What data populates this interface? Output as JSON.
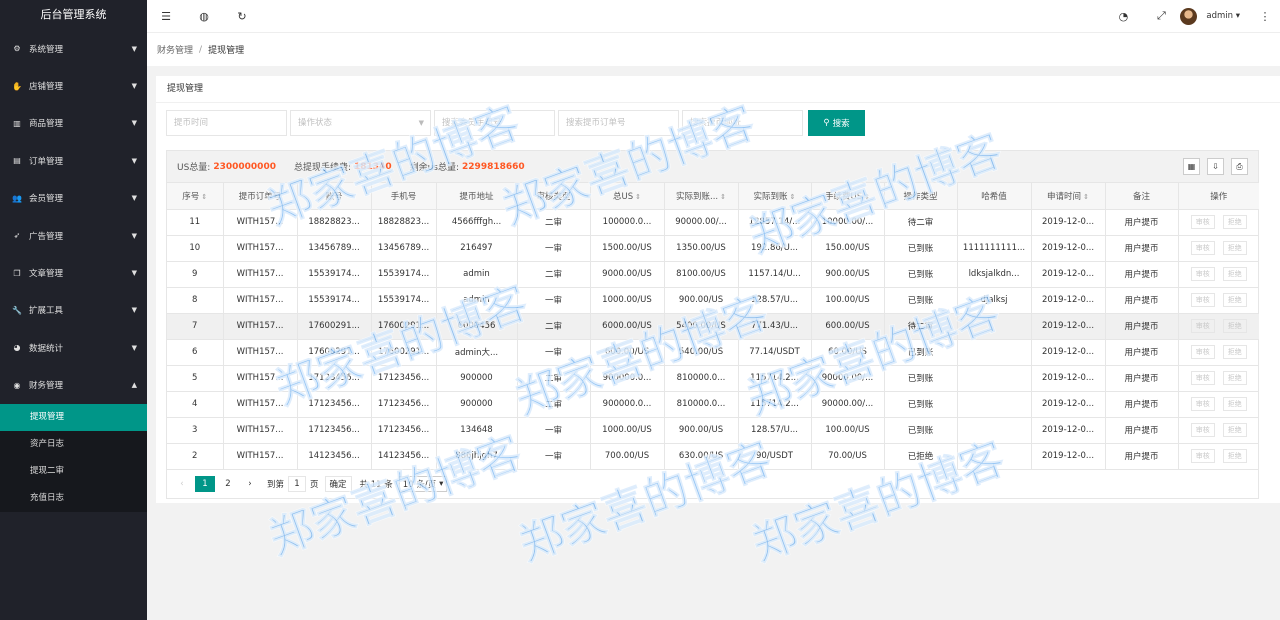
{
  "app": {
    "title": "后台管理系统"
  },
  "sidebar": {
    "items": [
      {
        "label": "系统管理",
        "icon": "gear-icon",
        "glyph": "⚙"
      },
      {
        "label": "店铺管理",
        "icon": "hand-icon",
        "glyph": "✋"
      },
      {
        "label": "商品管理",
        "icon": "bar-chart-icon",
        "glyph": "▥"
      },
      {
        "label": "订单管理",
        "icon": "calendar-icon",
        "glyph": "▤"
      },
      {
        "label": "会员管理",
        "icon": "users-icon",
        "glyph": "👥"
      },
      {
        "label": "广告管理",
        "icon": "rocket-icon",
        "glyph": "➶"
      },
      {
        "label": "文章管理",
        "icon": "copy-icon",
        "glyph": "❐"
      },
      {
        "label": "扩展工具",
        "icon": "wrench-icon",
        "glyph": "🔧"
      },
      {
        "label": "数据统计",
        "icon": "pie-chart-icon",
        "glyph": "◕"
      },
      {
        "label": "财务管理",
        "icon": "coin-icon",
        "glyph": "◉"
      }
    ],
    "submenu": [
      {
        "label": "提现管理",
        "active": true
      },
      {
        "label": "资产日志",
        "active": false
      },
      {
        "label": "提现二审",
        "active": false
      },
      {
        "label": "充值日志",
        "active": false
      }
    ]
  },
  "header": {
    "left_icons": [
      "menu-toggle-icon",
      "globe-icon",
      "refresh-icon"
    ],
    "right_icons": [
      "theme-icon",
      "fullscreen-icon"
    ],
    "user": "admin"
  },
  "breadcrumb": {
    "parent": "财务管理",
    "separator": "/",
    "current": "提现管理"
  },
  "card": {
    "title": "提现管理"
  },
  "search": {
    "time_placeholder": "提币时间",
    "status_placeholder": "操作状态",
    "phone_placeholder": "搜索会员手机号",
    "order_placeholder": "搜索提币订单号",
    "address_placeholder": "搜索提币地址",
    "button": "搜索"
  },
  "toolbar": {
    "total_label": "US总量:",
    "total_value": "2300000000",
    "fee_label": "总提现手续费:",
    "fee_value": "181340",
    "remain_label": "剩余us总量:",
    "remain_value": "2299818660"
  },
  "table": {
    "columns": [
      "序号",
      "提币订单号",
      "账号",
      "手机号",
      "提币地址",
      "审核类型",
      "总US",
      "实际到账...",
      "实际到账",
      "手续费US",
      "操作类型",
      "哈希值",
      "申请时间",
      "备注",
      "操作"
    ],
    "sortable": [
      true,
      false,
      false,
      false,
      false,
      false,
      true,
      true,
      true,
      true,
      false,
      false,
      true,
      false,
      false
    ],
    "rows": [
      [
        "11",
        "WITH157...",
        "18828823...",
        "18828823...",
        "4566fffgh...",
        "二审",
        "100000.0...",
        "90000.00/...",
        "12857.14/...",
        "10000.00/...",
        "待二审",
        "",
        "2019-12-0...",
        "用户提币"
      ],
      [
        "10",
        "WITH157...",
        "13456789...",
        "13456789...",
        "216497",
        "一审",
        "1500.00/US",
        "1350.00/US",
        "192.86/U...",
        "150.00/US",
        "已到账",
        "1111111111...",
        "2019-12-0...",
        "用户提币"
      ],
      [
        "9",
        "WITH157...",
        "15539174...",
        "15539174...",
        "admin",
        "二审",
        "9000.00/US",
        "8100.00/US",
        "1157.14/U...",
        "900.00/US",
        "已到账",
        "ldksjalkdn...",
        "2019-12-0...",
        "用户提币"
      ],
      [
        "8",
        "WITH157...",
        "15539174...",
        "15539174...",
        "admin",
        "一审",
        "1000.00/US",
        "900.00/US",
        "128.57/U...",
        "100.00/US",
        "已到账",
        "djalksj",
        "2019-12-0...",
        "用户提币"
      ],
      [
        "7",
        "WITH157...",
        "17600291...",
        "17600291...",
        "6000456",
        "二审",
        "6000.00/US",
        "5400.00/US",
        "771.43/U...",
        "600.00/US",
        "待二审",
        "",
        "2019-12-0...",
        "用户提币"
      ],
      [
        "6",
        "WITH157...",
        "17600291...",
        "17600291...",
        "admin大...",
        "一审",
        "600.00/US",
        "540.00/US",
        "77.14/USDT",
        "60.00/US",
        "已到账",
        "",
        "2019-12-0...",
        "用户提币"
      ],
      [
        "5",
        "WITH157...",
        "17123456...",
        "17123456...",
        "900000",
        "二审",
        "900000.0...",
        "810000.0...",
        "115714.2...",
        "90000.00/...",
        "已到账",
        "",
        "2019-12-0...",
        "用户提币"
      ],
      [
        "4",
        "WITH157...",
        "17123456...",
        "17123456...",
        "900000",
        "二审",
        "900000.0...",
        "810000.0...",
        "115714.2...",
        "90000.00/...",
        "已到账",
        "",
        "2019-12-0...",
        "用户提币"
      ],
      [
        "3",
        "WITH157...",
        "17123456...",
        "17123456...",
        "134648",
        "一审",
        "1000.00/US",
        "900.00/US",
        "128.57/U...",
        "100.00/US",
        "已到账",
        "",
        "2019-12-0...",
        "用户提币"
      ],
      [
        "2",
        "WITH157...",
        "14123456...",
        "14123456...",
        "886jhjgh7",
        "一审",
        "700.00/US",
        "630.00/US",
        "90/USDT",
        "70.00/US",
        "已拒绝",
        "",
        "2019-12-0...",
        "用户提币"
      ]
    ],
    "highlight_row": 4,
    "action_review": "审核",
    "action_reject": "拒绝"
  },
  "pager": {
    "pages": [
      "1",
      "2"
    ],
    "current": "1",
    "goto_label": "到第",
    "goto_value": "1",
    "page_unit": "页",
    "confirm": "确定",
    "total": "共 11 条",
    "page_size": "10 条/页"
  },
  "watermark": "郑家喜的博客"
}
